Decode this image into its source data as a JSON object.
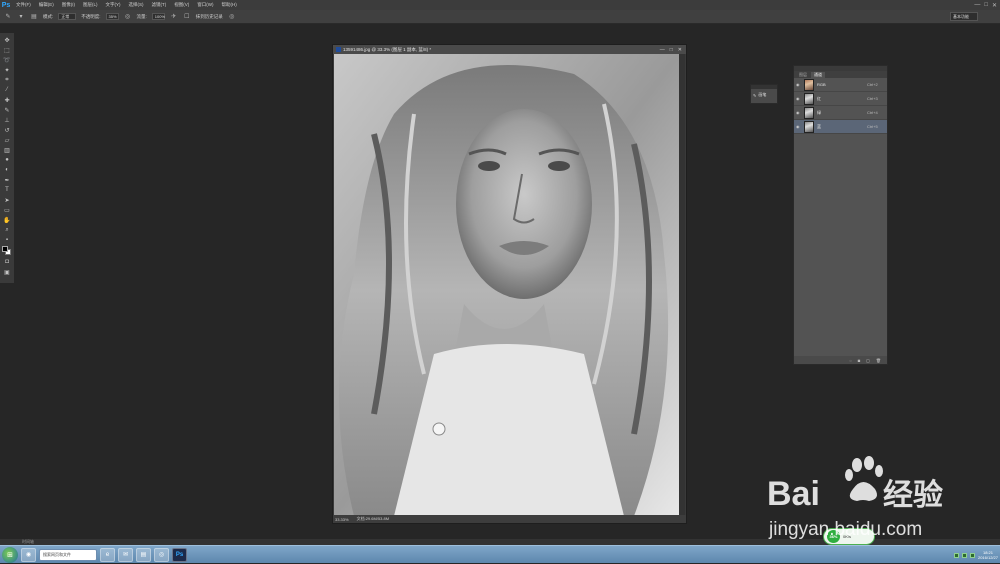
{
  "app": {
    "logo": "Ps"
  },
  "menu": [
    "文件(F)",
    "编辑(E)",
    "图像(I)",
    "图层(L)",
    "文字(Y)",
    "选择(S)",
    "滤镜(T)",
    "视图(V)",
    "窗口(W)",
    "帮助(H)"
  ],
  "window_controls": [
    "—",
    "□",
    "✕"
  ],
  "options": {
    "mode_label": "模式:",
    "mode_value": "正常",
    "opacity_label": "不透明度:",
    "opacity_value": "35%",
    "flow_label": "流量:",
    "flow_value": "100%",
    "history_label": "抹到历史记录",
    "workspace": "基本功能"
  },
  "document": {
    "title": "13591486.jpg @ 33.3% (图层 1 副本, 蓝/8) *",
    "zoom": "33.33%",
    "doc_size": "文档:29.6M/53.8M",
    "controls": [
      "—",
      "□",
      "✕"
    ]
  },
  "history_mini": {
    "label": "画笔"
  },
  "channels_panel": {
    "tabs": [
      "图层",
      "通道"
    ],
    "active_tab": 1,
    "channels": [
      {
        "name": "RGB",
        "key": "Ctrl+2",
        "thumb": "color"
      },
      {
        "name": "红",
        "key": "Ctrl+3",
        "thumb": "gray"
      },
      {
        "name": "绿",
        "key": "Ctrl+4",
        "thumb": "gray"
      },
      {
        "name": "蓝",
        "key": "Ctrl+5",
        "thumb": "gray",
        "selected": true
      }
    ]
  },
  "status_bar": {
    "label": "时间轴"
  },
  "taskbar": {
    "search_text": "搜索网页和文件",
    "time": "18:21",
    "date": "2016/12/27"
  },
  "float_widget": {
    "value": "36%",
    "text": "0K/s"
  },
  "watermark": {
    "brand": "Bai du 经验",
    "url": "jingyan.baidu.com"
  }
}
